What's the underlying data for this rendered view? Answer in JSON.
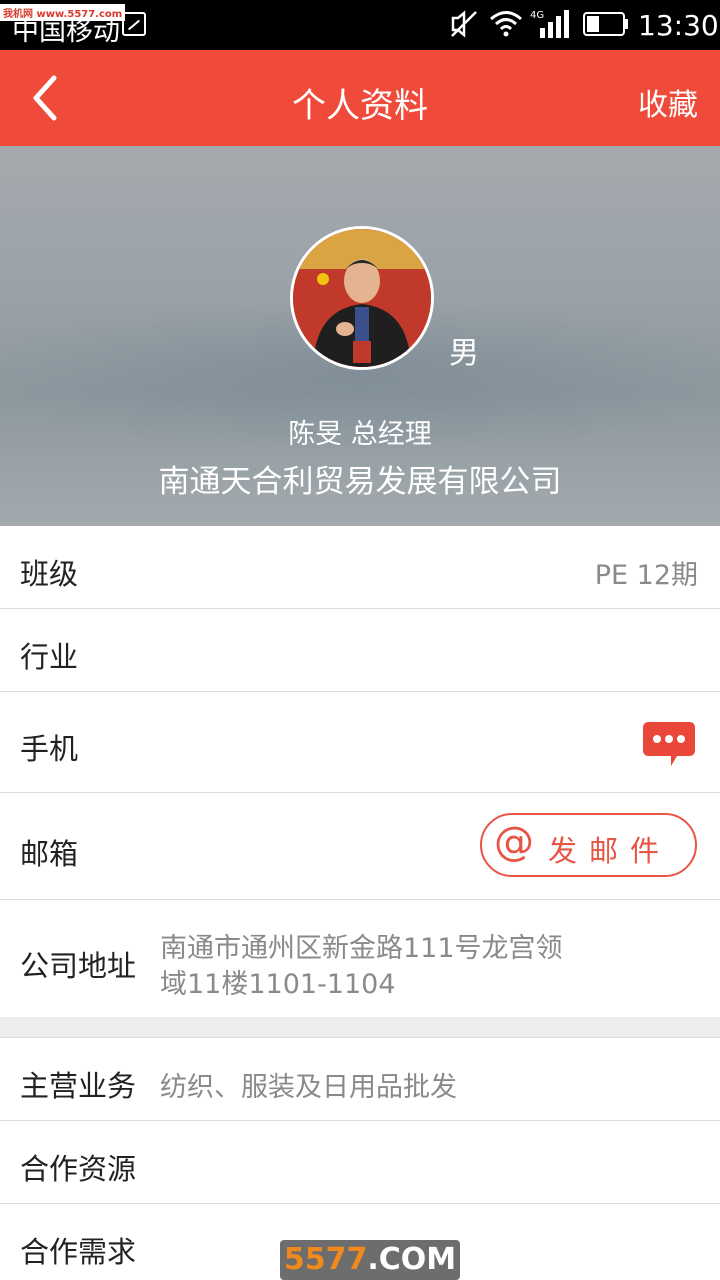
{
  "status_bar": {
    "carrier": "中国移动",
    "network": "4G",
    "time": "13:30",
    "watermark": "我机网 www.5577.com"
  },
  "nav": {
    "title": "个人资料",
    "favorite_label": "收藏"
  },
  "profile": {
    "gender": "男",
    "name_title": "陈旻 总经理",
    "company": "南通天合利贸易发展有限公司"
  },
  "rows": [
    {
      "label": "班级",
      "value": "PE 12期"
    },
    {
      "label": "行业",
      "value": ""
    },
    {
      "label": "手机",
      "value": ""
    },
    {
      "label": "邮箱",
      "value": ""
    },
    {
      "label": "公司地址",
      "value_line1": "南通市通州区新金路111号龙宫领",
      "value_line2": "域11楼1101-1104"
    }
  ],
  "rows2": [
    {
      "label": "主营业务",
      "value": "纺织、服装及日用品批发"
    },
    {
      "label": "合作资源",
      "value": ""
    },
    {
      "label": "合作需求",
      "value": ""
    }
  ],
  "email_button": {
    "at": "@",
    "label": "发邮件"
  },
  "watermark_bottom": {
    "part1": "5577",
    "part2": ".COM"
  },
  "colors": {
    "accent": "#ef4a3a",
    "email_border": "#e85545"
  }
}
